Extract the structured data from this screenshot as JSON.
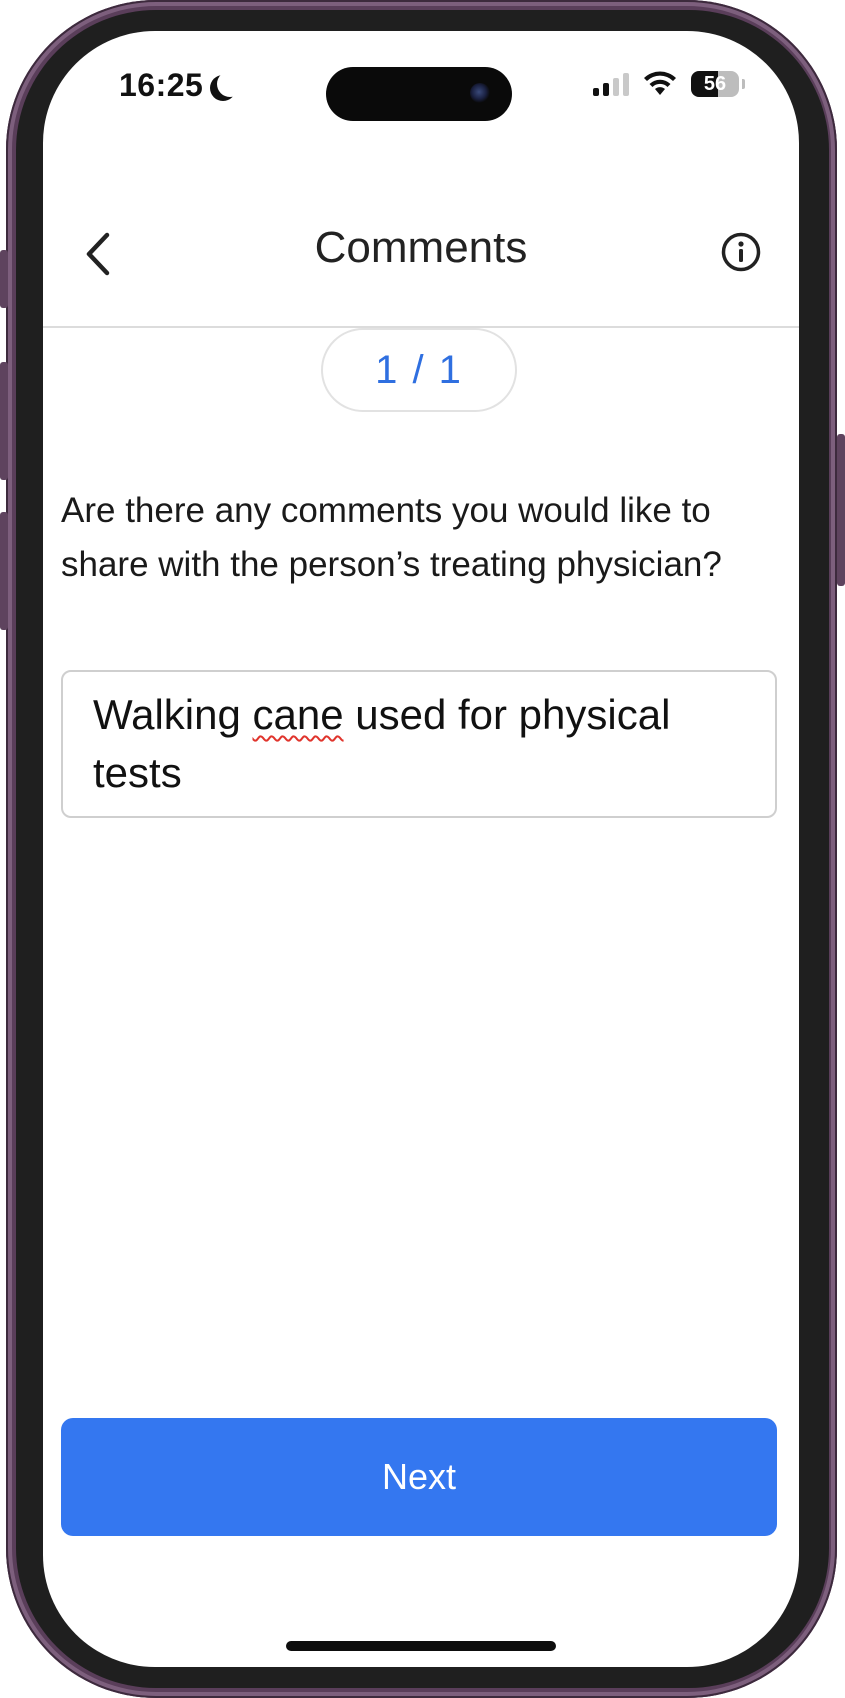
{
  "status_bar": {
    "time": "16:25",
    "battery_level": "56"
  },
  "nav": {
    "title": "Comments",
    "back_icon": "chevron-left-icon",
    "info_icon": "info-circle-icon"
  },
  "progress": {
    "label": "1 / 1"
  },
  "question": {
    "text": "Are there any comments you would like to share with the person’s treating physi­cian?"
  },
  "answer": {
    "before_typo": "Walking ",
    "typo_word": "cane",
    "after_typo": " used for physical tests"
  },
  "next_button": {
    "label": "Next",
    "color": "#3477f0"
  }
}
